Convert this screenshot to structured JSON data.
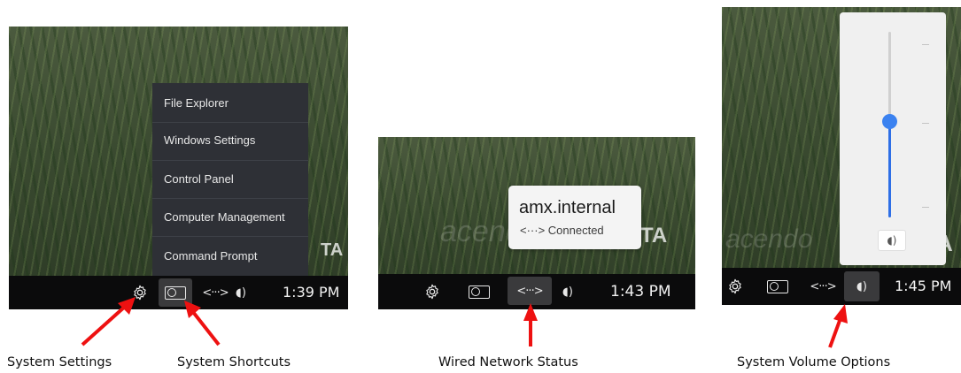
{
  "panel1": {
    "menu_items": [
      "File Explorer",
      "Windows Settings",
      "Control Panel",
      "Computer Management",
      "Command Prompt"
    ],
    "watermark_text": "TA",
    "clock": "1:39 PM",
    "icons": [
      "gear-icon",
      "shortcuts-icon",
      "network-icon",
      "volume-icon"
    ]
  },
  "panel2": {
    "tooltip_host": "amx.internal",
    "tooltip_status": "<···> Connected",
    "watermark_text": "TA",
    "watermark_brand": "acend",
    "clock": "1:43 PM"
  },
  "panel3": {
    "volume_level": 0.52,
    "watermark_text": "TA",
    "watermark_brand": "acendo",
    "clock": "1:45 PM"
  },
  "labels": {
    "system_settings": "System Settings",
    "system_shortcuts": "System Shortcuts",
    "wired_network_status": "Wired Network Status",
    "system_volume_options": "System Volume Options"
  },
  "glyphs": {
    "network": "<···>",
    "volume": "◖)"
  },
  "colors": {
    "taskbar": "#0b0b0c",
    "arrow": "#ee1111",
    "accent": "#3b82f0",
    "menu": "#2e3036"
  }
}
